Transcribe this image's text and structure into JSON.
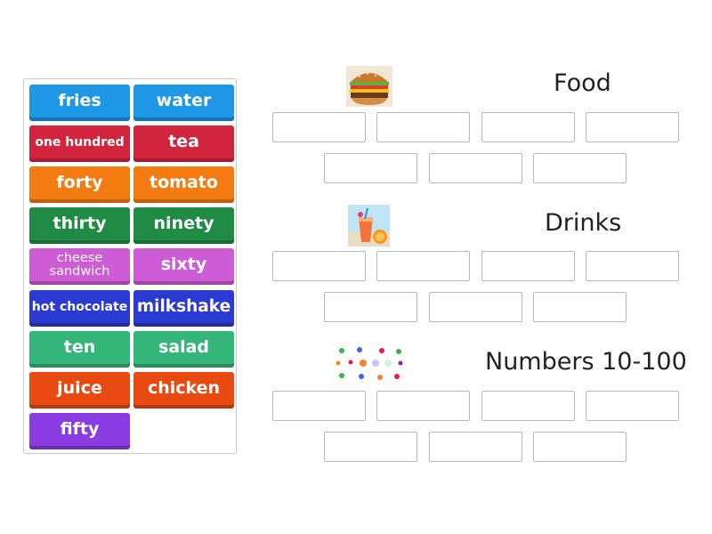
{
  "colors": {
    "blue": "#1e97e6",
    "red": "#d2253d",
    "orange": "#f47b12",
    "green": "#1f8b45",
    "pink": "#cd5cd6",
    "navy": "#2b3ad0",
    "mint": "#35b679",
    "redorange": "#e84a12",
    "purple": "#8a3be1"
  },
  "tiles": [
    {
      "label": "fries",
      "color": "blue"
    },
    {
      "label": "water",
      "color": "blue"
    },
    {
      "label": "one hundred",
      "color": "red"
    },
    {
      "label": "tea",
      "color": "red"
    },
    {
      "label": "forty",
      "color": "orange"
    },
    {
      "label": "tomato",
      "color": "orange"
    },
    {
      "label": "thirty",
      "color": "green"
    },
    {
      "label": "ninety",
      "color": "green"
    },
    {
      "label": "cheese sandwich",
      "color": "pink"
    },
    {
      "label": "sixty",
      "color": "pink"
    },
    {
      "label": "hot chocolate",
      "color": "navy"
    },
    {
      "label": "milkshake",
      "color": "navy"
    },
    {
      "label": "ten",
      "color": "mint"
    },
    {
      "label": "salad",
      "color": "mint"
    },
    {
      "label": "juice",
      "color": "redorange"
    },
    {
      "label": "chicken",
      "color": "redorange"
    },
    {
      "label": "fifty",
      "color": "purple"
    }
  ],
  "categories": [
    {
      "title": "Food",
      "image": "burger-icon"
    },
    {
      "title": "Drinks",
      "image": "drink-icon"
    },
    {
      "title": "Numbers 10-100",
      "image": "numbers-icon"
    }
  ]
}
